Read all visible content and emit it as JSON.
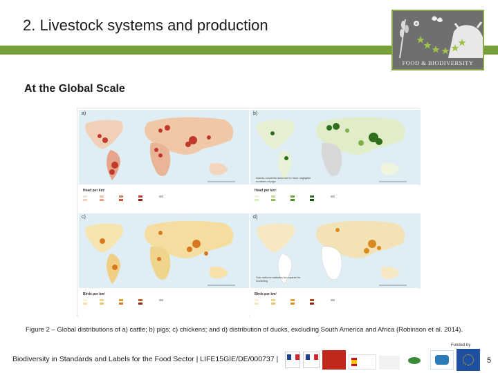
{
  "header": {
    "title": "2. Livestock systems and production",
    "logo_text": "FOOD & BIODIVERSITY"
  },
  "subtitle": "At the Global Scale",
  "figure": {
    "panels": [
      {
        "label": "a)",
        "legend_title": "Head per km²",
        "scale": "5,300",
        "unit": "km"
      },
      {
        "label": "b)",
        "legend_title": "Head per km²",
        "scale": "5,300",
        "unit": "km",
        "note": "Islamic countries assumed to have negligible numbers of pigs"
      },
      {
        "label": "c)",
        "legend_title": "Birds per km²",
        "scale": "5,300",
        "unit": "km"
      },
      {
        "label": "d)",
        "legend_title": "Birds per km²",
        "scale": "5,300",
        "unit": "km",
        "note": "Sub-national statistics too sparse for modelling"
      }
    ]
  },
  "caption": "Figure 2 – Global distributions of a) cattle; b) pigs; c) chickens; and d) distribution of ducks, excluding South America and Africa (Robinson et al. 2014).",
  "footer": {
    "funded_by": "Funded by",
    "text": "Biodiversity in Standards and Labels for the Food Sector | LIFE15GIE/DE/000737 |",
    "page": "5"
  },
  "colors": {
    "accent_green": "#77a03a",
    "cattle_red": "#c0392b",
    "pig_green": "#4a8a2a",
    "chicken_orange": "#e0a030",
    "duck_orange": "#d98a20"
  }
}
